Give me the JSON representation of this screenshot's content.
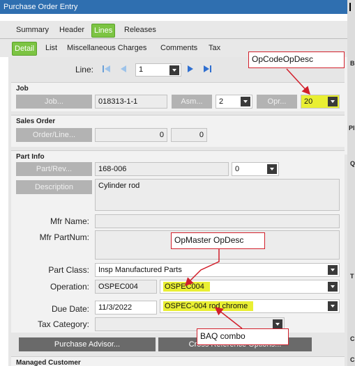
{
  "window": {
    "title": "Purchase Order Entry"
  },
  "main_tabs": [
    "Summary",
    "Header",
    "Lines",
    "Releases"
  ],
  "active_main_tab": "Lines",
  "sub_tabs": [
    "Detail",
    "List",
    "Miscellaneous Charges",
    "Comments",
    "Tax"
  ],
  "active_sub_tab": "Detail",
  "line": {
    "label": "Line:",
    "value": "1"
  },
  "job": {
    "title": "Job",
    "job_button": "Job...",
    "job_value": "018313-1-1",
    "asm_button": "Asm...",
    "asm_value": "2",
    "opr_button": "Opr...",
    "opr_value": "20"
  },
  "sales_order": {
    "title": "Sales Order",
    "order_button": "Order/Line...",
    "order_value": "0",
    "line_value": "0"
  },
  "part_info": {
    "title": "Part Info",
    "part_button": "Part/Rev...",
    "part_value": "168-006",
    "rev_value": "0",
    "description_button": "Description",
    "description_value": "Cylinder rod",
    "mfr_name_label": "Mfr Name:",
    "mfr_partnum_label": "Mfr PartNum:",
    "part_class_label": "Part Class:",
    "part_class_value": "Insp Manufactured Parts",
    "operation_label": "Operation:",
    "operation_code": "OSPEC004",
    "operation_combo": "OSPEC004",
    "due_date_label": "Due Date:",
    "due_date_value": "11/3/2022",
    "due_combo": "OSPEC-004 rod chrome",
    "tax_category_label": "Tax Category:"
  },
  "buttons": {
    "purchase_advisor": "Purchase Advisor...",
    "cross_reference": "Cross Reference Options..."
  },
  "managed_customer": {
    "title": "Managed Customer"
  },
  "callouts": {
    "opcode": "OpCodeOpDesc",
    "opmaster": "OpMaster OpDesc",
    "baq": "BAQ combo"
  },
  "right_edge_letters": [
    "B",
    "Pl",
    "Q",
    "T",
    "C",
    "C"
  ],
  "colors": {
    "accent_green": "#7cc443",
    "title_blue": "#2f6fb0",
    "highlight": "#e9ef33",
    "callout_red": "#d21f2b"
  }
}
